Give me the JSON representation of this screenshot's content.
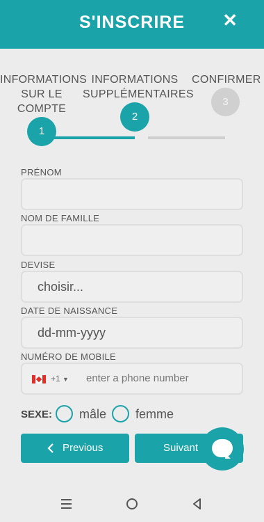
{
  "header": {
    "title": "S'INSCRIRE",
    "close_icon": "close-icon"
  },
  "steps": [
    {
      "number": "1",
      "label_lines": [
        "INFORMATIONS",
        "SUR LE",
        "COMPTE"
      ],
      "state": "completed"
    },
    {
      "number": "2",
      "label_lines": [
        "INFORMATIONS",
        "SUPPLÉMENTAIRES"
      ],
      "state": "active"
    },
    {
      "number": "3",
      "label_lines": [
        "CONFIRMER"
      ],
      "state": "pending"
    }
  ],
  "form": {
    "first_name": {
      "label": "PRÉNOM",
      "value": ""
    },
    "last_name": {
      "label": "NOM DE FAMILLE",
      "value": ""
    },
    "currency": {
      "label": "DEVISE",
      "value": "choisir..."
    },
    "birth_date": {
      "label": "DATE DE NAISSANCE",
      "placeholder": "dd-mm-yyyy"
    },
    "mobile": {
      "label": "NUMÉRO DE MOBILE",
      "country_code": "+1",
      "country_flag": "canada-flag",
      "placeholder": "enter a phone number"
    },
    "sex": {
      "label": "SEXE:",
      "options": [
        "mâle",
        "femme"
      ],
      "selected": null
    }
  },
  "buttons": {
    "previous": "Previous",
    "next": "Suivant"
  },
  "chat_icon": "chat-bubble-icon",
  "system_nav": {
    "icons": [
      "menu-icon",
      "home-icon",
      "back-icon"
    ]
  },
  "colors": {
    "accent": "#1aa3a8",
    "inactive": "#cfcfcf",
    "background": "#ececec"
  }
}
